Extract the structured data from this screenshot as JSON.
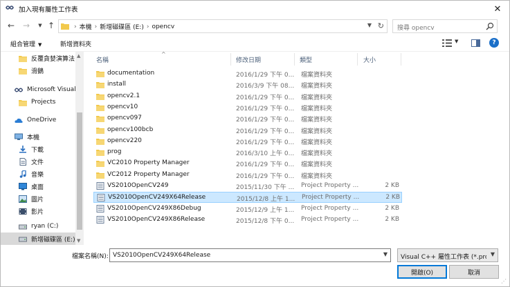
{
  "window": {
    "title": "加入現有屬性工作表",
    "close_glyph": "✕"
  },
  "address": {
    "crumbs": [
      "本機",
      "新增磁碟區 (E:)",
      "opencv"
    ],
    "separator": "›",
    "search_placeholder": "搜尋 opencv"
  },
  "toolbar": {
    "organize": "組合管理",
    "new_folder": "新增資料夾"
  },
  "nav": {
    "items": [
      {
        "label": "反覆貪婪演算法",
        "icon": "folder"
      },
      {
        "label": "滑鵝",
        "icon": "folder"
      },
      {
        "label": "Microsoft Visual",
        "icon": "vs"
      },
      {
        "label": "Projects",
        "icon": "folder"
      },
      {
        "label": "OneDrive",
        "icon": "cloud"
      },
      {
        "label": "本機",
        "icon": "pc"
      },
      {
        "label": "下載",
        "icon": "download"
      },
      {
        "label": "文件",
        "icon": "document"
      },
      {
        "label": "音樂",
        "icon": "music"
      },
      {
        "label": "桌面",
        "icon": "desktop"
      },
      {
        "label": "圖片",
        "icon": "picture"
      },
      {
        "label": "影片",
        "icon": "video"
      },
      {
        "label": "ryan (C:)",
        "icon": "drive"
      },
      {
        "label": "新增磁碟區 (E:)",
        "icon": "drive",
        "selected": true
      }
    ]
  },
  "columns": {
    "name": "名稱",
    "date": "修改日期",
    "type": "類型",
    "size": "大小"
  },
  "files": [
    {
      "name": "documentation",
      "date": "2016/1/29 下午 0...",
      "type": "檔案資料夾",
      "size": "",
      "icon": "folder"
    },
    {
      "name": "install",
      "date": "2016/3/9 下午 08...",
      "type": "檔案資料夾",
      "size": "",
      "icon": "folder"
    },
    {
      "name": "opencv2.1",
      "date": "2016/1/29 下午 0...",
      "type": "檔案資料夾",
      "size": "",
      "icon": "folder"
    },
    {
      "name": "opencv10",
      "date": "2016/1/29 下午 0...",
      "type": "檔案資料夾",
      "size": "",
      "icon": "folder"
    },
    {
      "name": "opencv097",
      "date": "2016/1/29 下午 0...",
      "type": "檔案資料夾",
      "size": "",
      "icon": "folder"
    },
    {
      "name": "opencv100bcb",
      "date": "2016/1/29 下午 0...",
      "type": "檔案資料夾",
      "size": "",
      "icon": "folder"
    },
    {
      "name": "opencv220",
      "date": "2016/1/29 下午 0...",
      "type": "檔案資料夾",
      "size": "",
      "icon": "folder"
    },
    {
      "name": "prog",
      "date": "2016/3/10 上午 0...",
      "type": "檔案資料夾",
      "size": "",
      "icon": "folder"
    },
    {
      "name": "VC2010 Property Manager",
      "date": "2016/1/29 下午 0...",
      "type": "檔案資料夾",
      "size": "",
      "icon": "folder"
    },
    {
      "name": "VC2012 Property Manager",
      "date": "2016/1/29 下午 0...",
      "type": "檔案資料夾",
      "size": "",
      "icon": "folder"
    },
    {
      "name": "VS2010OpenCV249",
      "date": "2015/11/30 下午 ...",
      "type": "Project Property ...",
      "size": "2 KB",
      "icon": "props"
    },
    {
      "name": "VS2010OpenCV249X64Release",
      "date": "2015/12/8 上午 1...",
      "type": "Project Property ...",
      "size": "2 KB",
      "icon": "props",
      "selected": true
    },
    {
      "name": "VS2010OpenCV249X86Debug",
      "date": "2015/12/9 上午 1...",
      "type": "Project Property ...",
      "size": "2 KB",
      "icon": "props"
    },
    {
      "name": "VS2010OpenCV249X86Release",
      "date": "2015/12/8 下午 0...",
      "type": "Project Property ...",
      "size": "2 KB",
      "icon": "props"
    }
  ],
  "bottom": {
    "filename_label": "檔案名稱(N):",
    "filename_value": "VS2010OpenCV249X64Release",
    "filetype_value": "Visual C++ 屬性工作表 (*.props)",
    "open_button": "開啟(O)",
    "cancel_button": "取消"
  },
  "colors": {
    "folder": "#f2c94c",
    "selection": "#cce8ff",
    "accent": "#0078d7"
  }
}
